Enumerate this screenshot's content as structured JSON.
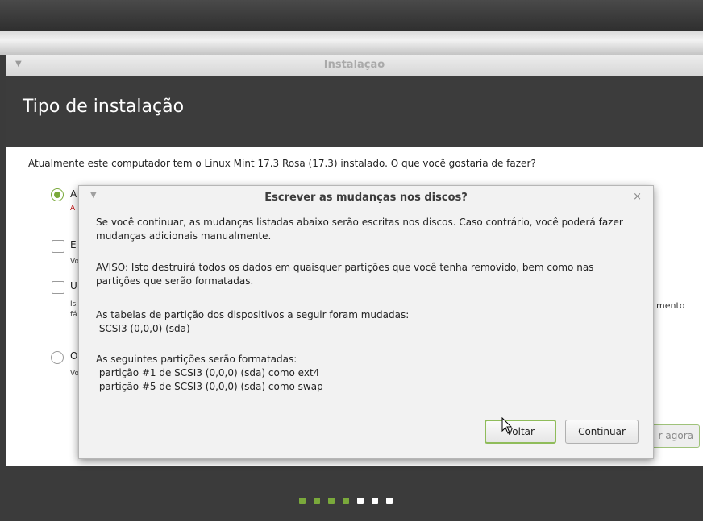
{
  "window": {
    "title": "Instalação",
    "header": "Tipo de instalação"
  },
  "question": "Atualmente este computador tem o Linux Mint 17.3 Rosa (17.3) instalado. O que você gostaria de fazer?",
  "options": [
    {
      "label": "A",
      "sub": "A",
      "selected": true
    },
    {
      "label": "E",
      "sub": "Vo"
    },
    {
      "label": "U",
      "sub1": "Is",
      "sub2": "fá"
    },
    {
      "label": "O",
      "sub": "Vo"
    }
  ],
  "right_fragment": "mento",
  "install_button": "r agora",
  "progress": {
    "total": 7,
    "completed": 4,
    "done_color": "#7aa93b",
    "todo_color": "#ffffff"
  },
  "dialog": {
    "title": "Escrever as mudanças nos discos?",
    "close_glyph": "×",
    "para1_line1": "Se você continuar, as mudanças listadas abaixo serão escritas nos discos. Caso contrário, você poderá fazer",
    "para1_line2": "mudanças adicionais manualmente.",
    "para2_line1": "AVISO: Isto destruirá todos os dados em quaisquer partições que você tenha removido, bem como nas",
    "para2_line2": "partições que serão formatadas.",
    "para3_line1": "As tabelas de partição dos dispositivos a seguir foram mudadas:",
    "para3_line2": " SCSI3 (0,0,0) (sda)",
    "para4_line1": "As seguintes partições serão formatadas:",
    "para4_line2": " partição #1 de SCSI3 (0,0,0) (sda) como ext4",
    "para4_line3": " partição #5 de SCSI3 (0,0,0) (sda) como swap",
    "back_button": "Voltar",
    "continue_button": "Continuar"
  },
  "colors": {
    "accent": "#7aa93b",
    "header_bg": "#3c3c3c",
    "warning_red": "#c01010"
  }
}
